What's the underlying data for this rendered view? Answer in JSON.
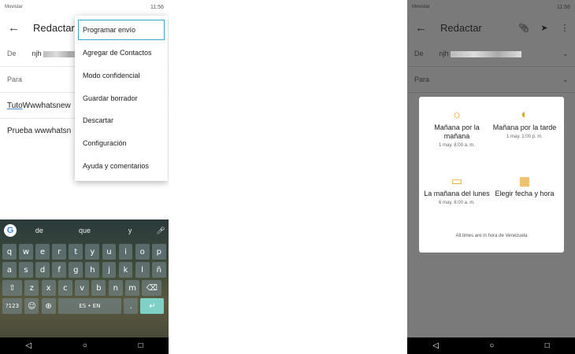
{
  "left": {
    "status": {
      "carrier": "Movistar",
      "time": "11:56"
    },
    "appbar": {
      "back_icon": "←",
      "title": "Redactar"
    },
    "from": {
      "label": "De",
      "value": "njh"
    },
    "to": {
      "label": "Para"
    },
    "subject": {
      "underlined": "Tuto",
      "rest": " Wwwhatsnew"
    },
    "body": "Prueba wwwhatsn",
    "menu": [
      "Programar envío",
      "Agregar de Contactos",
      "Modo confidencial",
      "Guardar borrador",
      "Descartar",
      "Configuración",
      "Ayuda y comentarios"
    ],
    "keyboard": {
      "suggestions": [
        "de",
        "que",
        "y"
      ],
      "row1": [
        "q",
        "w",
        "e",
        "r",
        "t",
        "y",
        "u",
        "i",
        "o",
        "p"
      ],
      "row2": [
        "a",
        "s",
        "d",
        "f",
        "g",
        "h",
        "j",
        "k",
        "l",
        "ñ"
      ],
      "row3": [
        "z",
        "x",
        "c",
        "v",
        "b",
        "n",
        "m"
      ],
      "sym": "?123",
      "space": "ES • EN",
      "period": "."
    }
  },
  "right": {
    "status": {
      "carrier": "Movistar",
      "time": "11:56"
    },
    "appbar": {
      "back_icon": "←",
      "title": "Redactar"
    },
    "from": {
      "label": "De",
      "value": "njh"
    },
    "to": {
      "label": "Para"
    },
    "dialog": {
      "options": [
        {
          "label": "Mañana por la mañana",
          "sub": "1 may. 8:00 a. m.",
          "icon": "sun-icon"
        },
        {
          "label": "Mañana por la tarde",
          "sub": "1 may. 1:00 p. m.",
          "icon": "half-sun-icon"
        },
        {
          "label": "La mañana del lunes",
          "sub": "6 may. 8:00 a. m.",
          "icon": "briefcase-icon"
        },
        {
          "label": "Elegir fecha y hora",
          "sub": "",
          "icon": "calendar-icon"
        }
      ],
      "timezone": "All times are in hora de Venezuela"
    }
  },
  "colors": {
    "accent": "#e2a320",
    "highlight": "#3aa3d6",
    "scrim": "#7a7a7a"
  }
}
